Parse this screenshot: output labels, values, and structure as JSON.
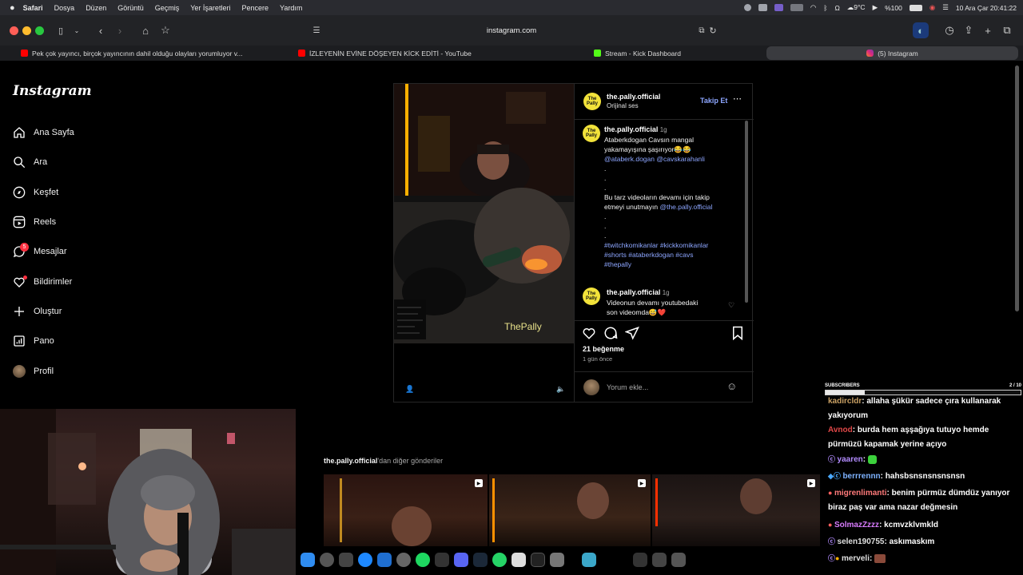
{
  "menubar": {
    "app": "Safari",
    "items": [
      "Dosya",
      "Düzen",
      "Görüntü",
      "Geçmiş",
      "Yer İşaretleri",
      "Pencere",
      "Yardım"
    ],
    "weather": "9°C",
    "battery": "%100",
    "datetime": "10 Ara Çar  20:41:22"
  },
  "browser": {
    "url": "instagram.com",
    "tabs": [
      {
        "label": "Pek çok yayıncı, birçok yayıncının dahil olduğu olayları yorumluyor v...",
        "color": "#ff0000"
      },
      {
        "label": "İZLEYENİN EVİNE DÖŞEYEN KİCK EDİTİ - YouTube",
        "color": "#ff0000"
      },
      {
        "label": "Stream - Kick Dashboard",
        "color": "#53fc18"
      },
      {
        "label": "(5) Instagram",
        "color": "#e1306c"
      }
    ]
  },
  "instagram": {
    "logo": "Instagram",
    "nav": [
      {
        "label": "Ana Sayfa",
        "icon": "home-icon"
      },
      {
        "label": "Ara",
        "icon": "search-icon"
      },
      {
        "label": "Keşfet",
        "icon": "compass-icon"
      },
      {
        "label": "Reels",
        "icon": "reels-icon"
      },
      {
        "label": "Mesajlar",
        "icon": "messenger-icon",
        "badge": "5"
      },
      {
        "label": "Bildirimler",
        "icon": "heart-icon"
      },
      {
        "label": "Oluştur",
        "icon": "plus-icon"
      },
      {
        "label": "Pano",
        "icon": "dashboard-icon"
      },
      {
        "label": "Profil",
        "icon": "profile-avatar"
      }
    ],
    "post": {
      "username": "the.pally.official",
      "audio": "Orijinal ses",
      "follow": "Takip Et",
      "avatar_text": "The Pally",
      "video_watermark": "ThePally",
      "caption": {
        "username": "the.pally.official",
        "time": "1g",
        "line1": "Ataberkdogan Cavsın mangal",
        "line2": "yakamayışına şaşırıyor😂😂",
        "mentions": "@ataberk.dogan @cavskarahanli",
        "dot": ".",
        "cta1": "Bu tarz videoların devamı için takip",
        "cta2": "etmeyi unutmayın",
        "cta_mention": "@the.pally.official",
        "tags1": "#twitchkomikanlar #kickkomikanlar",
        "tags2": "#shorts #ataberkdogan #cavs",
        "tags3": "#thepally"
      },
      "comment": {
        "username": "the.pally.official",
        "time": "1g",
        "line1": "Videonun devamı youtubedaki",
        "line2": "son videomda😅❤️"
      },
      "likes": "21 beğenme",
      "date": "1 gün önce",
      "comment_placeholder": "Yorum ekle..."
    },
    "more_posts": {
      "owner": "the.pally.official",
      "suffix": "'dan diğer gönderiler"
    }
  },
  "overlay": {
    "subs_label": "SUBSCRIBERS",
    "subs_count": "2 / 10",
    "subs_progress": 0.2,
    "chat": [
      {
        "user": "kadircldr",
        "color": "#c9a064",
        "msg": ": allaha şükür sadece çıra kullanarak yakıyorum"
      },
      {
        "user": "Avnod",
        "color": "#e04848",
        "msg": ": burda hem aşşağıya tutuyo hemde pürmüzü kapamak yerine açıyo"
      },
      {
        "user": "yaaren",
        "color": "#b38cff",
        "msg": ":"
      },
      {
        "user": "berrrennn",
        "color": "#7fb3ff",
        "msg": ": hahsbsnsnsnsnsnsn"
      },
      {
        "user": "migrenlimanti",
        "color": "#ff7a7a",
        "msg": ": benim pürmüz dümdüz yanıyor biraz paş var ama nazar değmesin"
      },
      {
        "user": "SolmazZzzz",
        "color": "#d97cff",
        "msg": ": kcmvzklvmkld"
      },
      {
        "user": "selen190755",
        "color": "#b38cff",
        "msg": ": askımaskım"
      },
      {
        "user": "merveli",
        "color": "#ffd24a",
        "msg": ":"
      }
    ]
  }
}
